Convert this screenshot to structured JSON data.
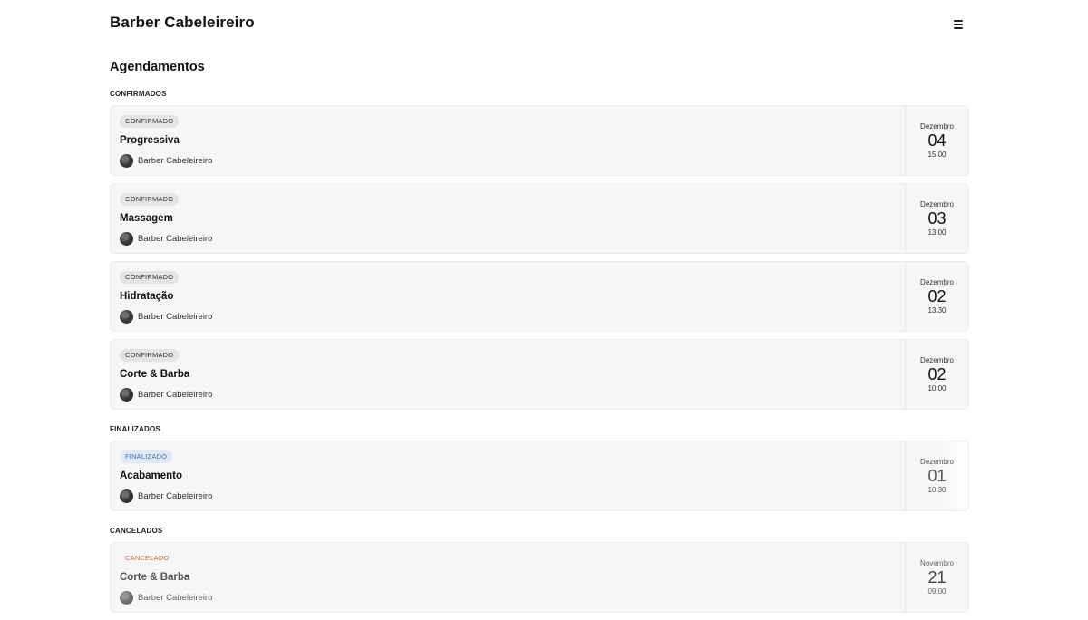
{
  "app": {
    "brand": "Barber Cabeleireiro",
    "menu_icon": "hamburger-menu-icon"
  },
  "page": {
    "title": "Agendamentos"
  },
  "sections": {
    "confirmed": {
      "label": "CONFIRMADOS",
      "items": [
        {
          "status": "CONFIRMADO",
          "service": "Progressiva",
          "barber": "Barber Cabeleireiro",
          "month": "Dezembro",
          "day": "04",
          "time": "15:00"
        },
        {
          "status": "CONFIRMADO",
          "service": "Massagem",
          "barber": "Barber Cabeleireiro",
          "month": "Dezembro",
          "day": "03",
          "time": "13:00"
        },
        {
          "status": "CONFIRMADO",
          "service": "Hidratação",
          "barber": "Barber Cabeleireiro",
          "month": "Dezembro",
          "day": "02",
          "time": "13:30"
        },
        {
          "status": "CONFIRMADO",
          "service": "Corte & Barba",
          "barber": "Barber Cabeleireiro",
          "month": "Dezembro",
          "day": "02",
          "time": "10:00"
        }
      ]
    },
    "finished": {
      "label": "FINALIZADOS",
      "items": [
        {
          "status": "FINALIZADO",
          "service": "Acabamento",
          "barber": "Barber Cabeleireiro",
          "month": "Dezembro",
          "day": "01",
          "time": "10:30"
        }
      ]
    },
    "cancelled": {
      "label": "CANCELADOS",
      "items": [
        {
          "status": "CANCELADO",
          "service": "Corte & Barba",
          "barber": "Barber Cabeleireiro",
          "month": "Novembro",
          "day": "21",
          "time": "09:00"
        }
      ]
    }
  },
  "colors": {
    "card_bg": "#f6f6f6",
    "finished_badge": "#3a74b5",
    "cancelled_badge": "#c36b3a"
  }
}
